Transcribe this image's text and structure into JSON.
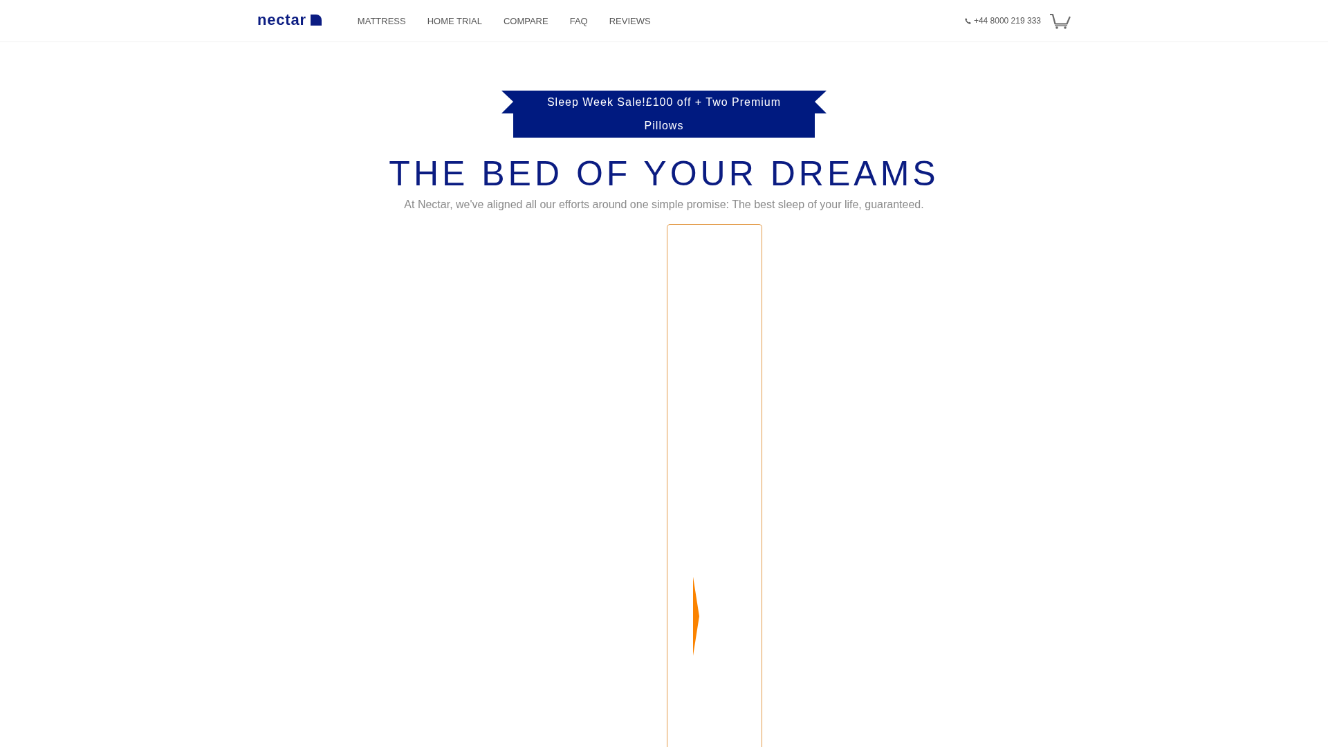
{
  "header": {
    "logo": "nectar",
    "nav": [
      {
        "label": "MATTRESS"
      },
      {
        "label": "HOME TRIAL"
      },
      {
        "label": "COMPARE"
      },
      {
        "label": "FAQ"
      },
      {
        "label": "REVIEWS"
      }
    ],
    "phone": "+44 8000 219 333"
  },
  "banner": {
    "text": "Sleep Week Sale!£100 off + Two Premium Pillows"
  },
  "hero": {
    "title": "THE BED OF YOUR DREAMS",
    "subtitle": "At Nectar, we've aligned all our efforts around one simple promise: The best sleep of your life, guaranteed."
  }
}
